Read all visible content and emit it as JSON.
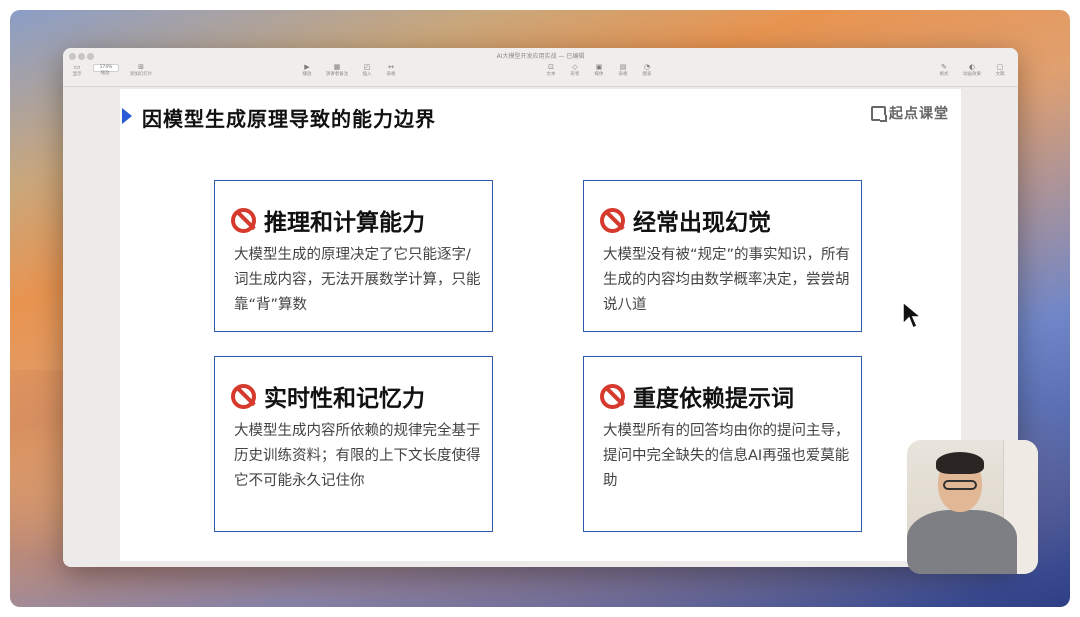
{
  "window": {
    "title": "AI大模型开发应用实战",
    "title_suffix": "— 已编辑"
  },
  "toolbar": {
    "left": [
      {
        "icon": "sidebar-icon",
        "label": "显示"
      },
      {
        "icon": "zoom-icon",
        "label": "缩放",
        "value": "174%"
      },
      {
        "icon": "add-slide-icon",
        "label": "添加幻灯片"
      }
    ],
    "center": [
      {
        "icon": "play-icon",
        "label": "播放"
      },
      {
        "icon": "table-icon",
        "label": "演讲者备注"
      },
      {
        "icon": "image-icon",
        "label": "插入"
      },
      {
        "icon": "shape-icon",
        "label": "表格"
      }
    ],
    "center_right": [
      {
        "icon": "text-icon",
        "label": "文本"
      },
      {
        "icon": "shape-icon",
        "label": "形状"
      },
      {
        "icon": "media-icon",
        "label": "媒体"
      },
      {
        "icon": "comment-icon",
        "label": "表格"
      },
      {
        "icon": "chart-icon",
        "label": "图表"
      }
    ],
    "right": [
      {
        "icon": "format-icon",
        "label": "格式"
      },
      {
        "icon": "animate-icon",
        "label": "动画效果"
      },
      {
        "icon": "document-icon",
        "label": "文稿"
      }
    ]
  },
  "slide": {
    "title": "因模型生成原理导致的能力边界",
    "logo_text": "起点课堂",
    "cards": [
      {
        "title": "推理和计算能力",
        "body": "大模型生成的原理决定了它只能逐字/词生成内容，无法开展数学计算，只能靠“背”算数"
      },
      {
        "title": "经常出现幻觉",
        "body": "大模型没有被“规定”的事实知识，所有生成的内容均由数学概率决定，尝尝胡说八道"
      },
      {
        "title": "实时性和记忆力",
        "body": "大模型生成内容所依赖的规律完全基于历史训练资料；有限的上下文长度使得它不可能永久记住你"
      },
      {
        "title": "重度依赖提示词",
        "body": "大模型所有的回答均由你的提问主导，提问中完全缺失的信息AI再强也爱莫能助"
      }
    ]
  },
  "colors": {
    "accent": "#2a5bd7",
    "card_border": "#2e59b5",
    "ban_red": "#d63a2c"
  }
}
